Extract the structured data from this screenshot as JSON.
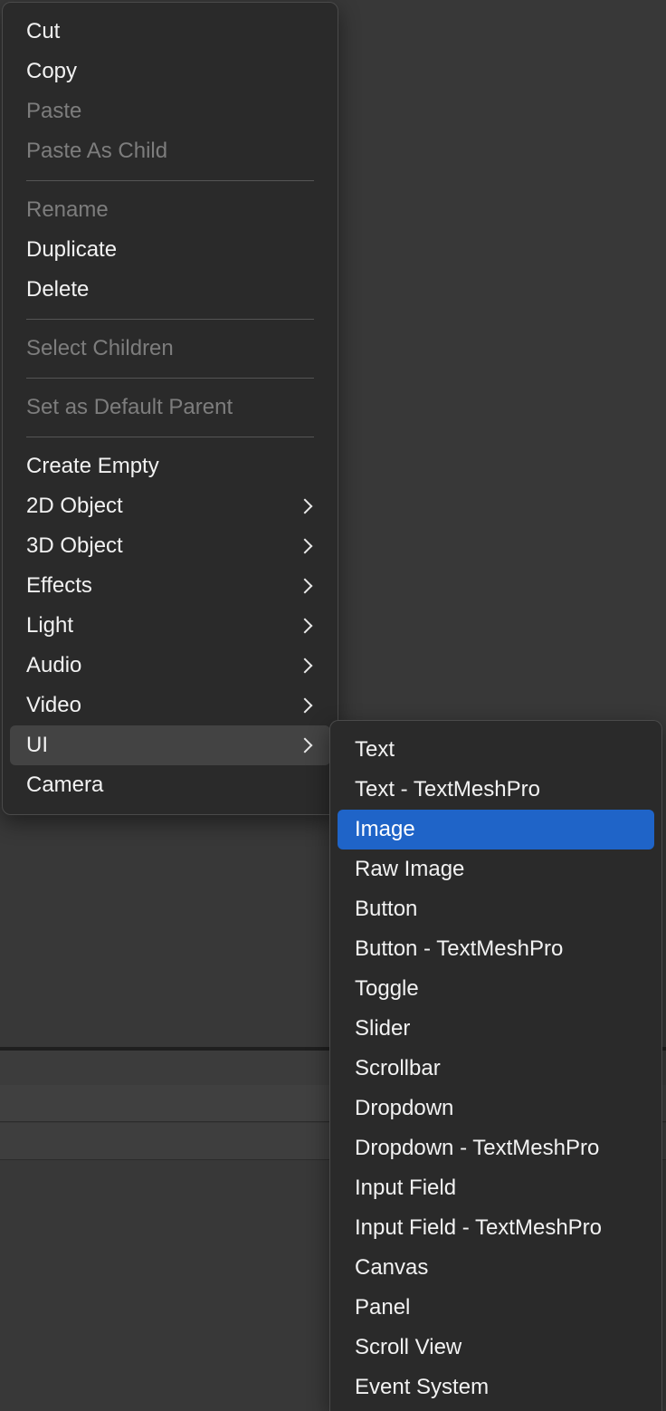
{
  "context_menu": {
    "groups": [
      [
        {
          "label": "Cut",
          "enabled": true
        },
        {
          "label": "Copy",
          "enabled": true
        },
        {
          "label": "Paste",
          "enabled": false
        },
        {
          "label": "Paste As Child",
          "enabled": false
        }
      ],
      [
        {
          "label": "Rename",
          "enabled": false
        },
        {
          "label": "Duplicate",
          "enabled": true
        },
        {
          "label": "Delete",
          "enabled": true
        }
      ],
      [
        {
          "label": "Select Children",
          "enabled": false
        }
      ],
      [
        {
          "label": "Set as Default Parent",
          "enabled": false
        }
      ],
      [
        {
          "label": "Create Empty",
          "enabled": true
        },
        {
          "label": "2D Object",
          "enabled": true,
          "submenu": true
        },
        {
          "label": "3D Object",
          "enabled": true,
          "submenu": true
        },
        {
          "label": "Effects",
          "enabled": true,
          "submenu": true
        },
        {
          "label": "Light",
          "enabled": true,
          "submenu": true
        },
        {
          "label": "Audio",
          "enabled": true,
          "submenu": true
        },
        {
          "label": "Video",
          "enabled": true,
          "submenu": true
        },
        {
          "label": "UI",
          "enabled": true,
          "submenu": true,
          "active": true
        },
        {
          "label": "Camera",
          "enabled": true
        }
      ]
    ]
  },
  "ui_submenu": {
    "items": [
      {
        "label": "Text"
      },
      {
        "label": "Text - TextMeshPro"
      },
      {
        "label": "Image",
        "selected": true
      },
      {
        "label": "Raw Image"
      },
      {
        "label": "Button"
      },
      {
        "label": "Button - TextMeshPro"
      },
      {
        "label": "Toggle"
      },
      {
        "label": "Slider"
      },
      {
        "label": "Scrollbar"
      },
      {
        "label": "Dropdown"
      },
      {
        "label": "Dropdown - TextMeshPro"
      },
      {
        "label": "Input Field"
      },
      {
        "label": "Input Field - TextMeshPro"
      },
      {
        "label": "Canvas"
      },
      {
        "label": "Panel"
      },
      {
        "label": "Scroll View"
      },
      {
        "label": "Event System"
      }
    ]
  },
  "colors": {
    "menu_bg": "#2a2a2a",
    "selection": "#1f64c8",
    "hover": "#434343",
    "text": "#f2f2f2",
    "disabled_text": "#7d7d7d"
  },
  "icons": {
    "submenu_arrow": "chevron-right-icon"
  }
}
